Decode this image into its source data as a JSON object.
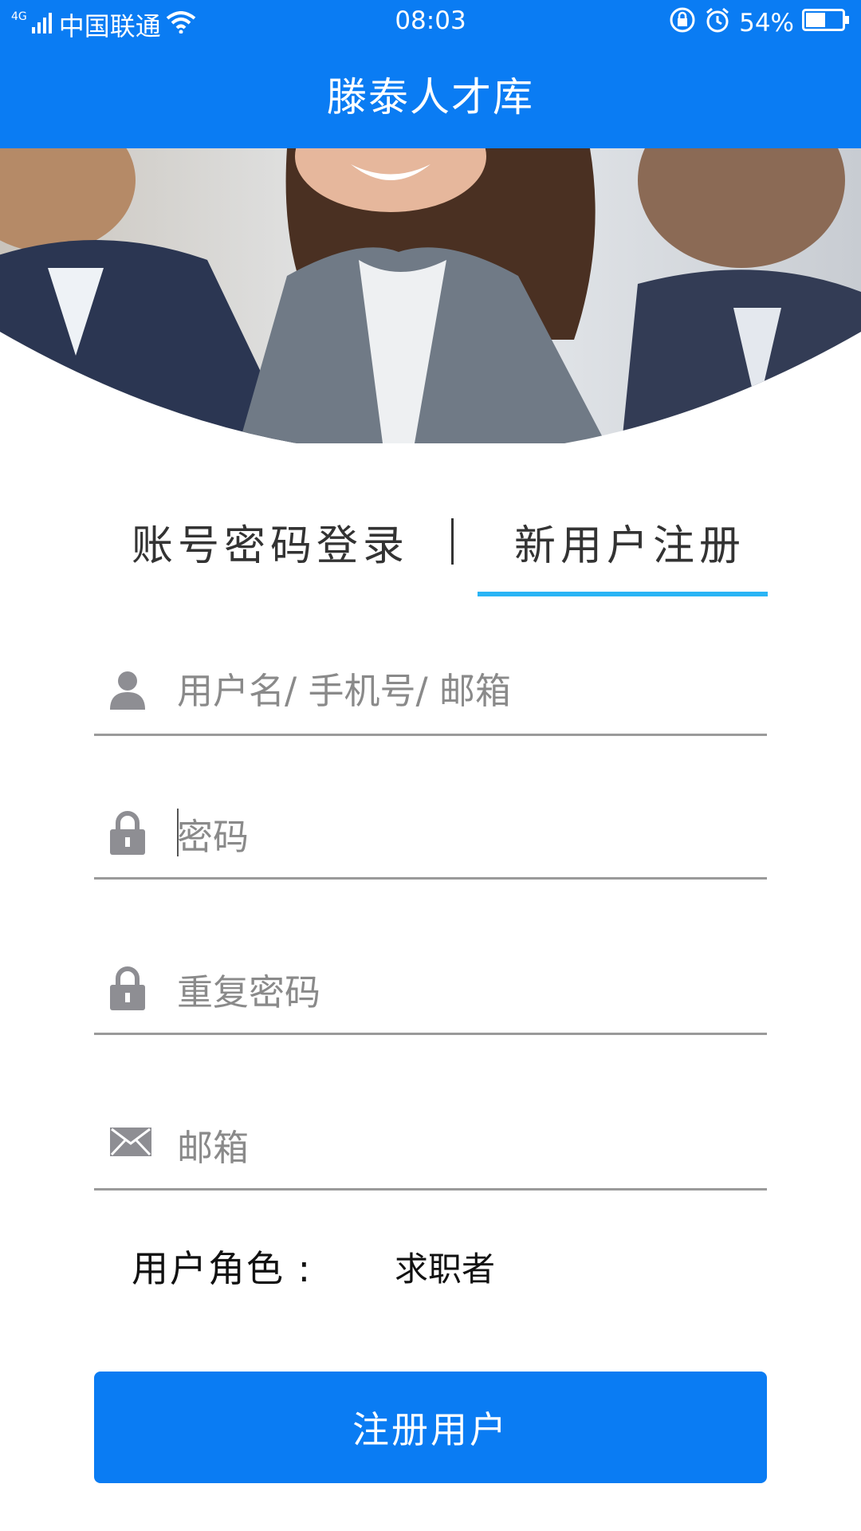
{
  "status_bar": {
    "network": "4G",
    "carrier": "中国联通",
    "time": "08:03",
    "battery": "54%",
    "battery_level": 0.54
  },
  "header": {
    "title": "滕泰人才库"
  },
  "tabs": {
    "login_label": "账号密码登录",
    "register_label": "新用户注册",
    "active": "register"
  },
  "form": {
    "username_placeholder": "用户名/ 手机号/ 邮箱",
    "password_placeholder": "密码",
    "repeat_password_placeholder": "重复密码",
    "email_placeholder": "邮箱",
    "role_label": "用户角色 :",
    "role_value": "求职者",
    "submit_label": "注册用户"
  },
  "colors": {
    "brand": "#0a7cf3",
    "tab_underline": "#2ab4f5",
    "icon_gray": "#8e8e93"
  },
  "icons": {
    "username": "user-icon",
    "password": "lock-icon",
    "repeat_password": "lock-icon",
    "email": "mail-icon"
  }
}
